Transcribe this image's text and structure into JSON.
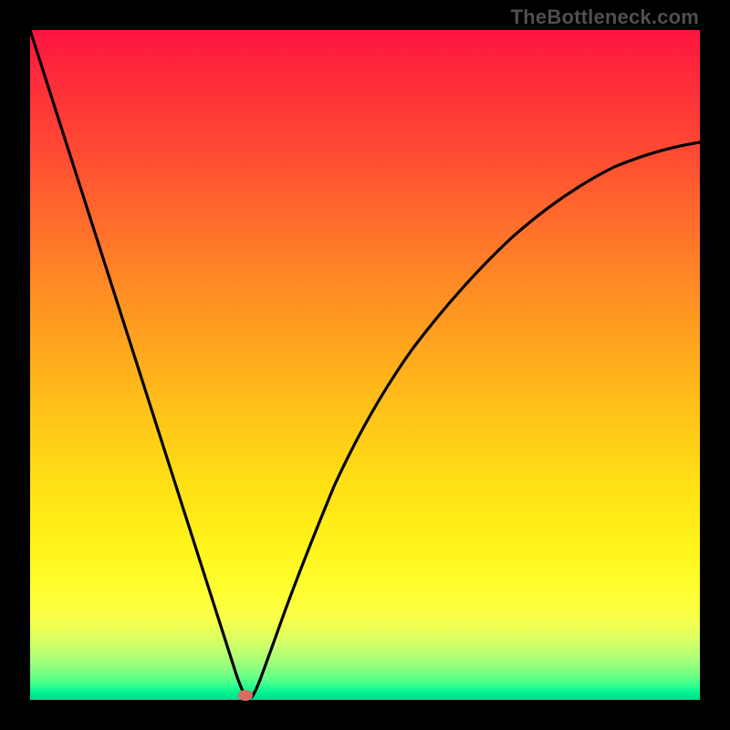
{
  "watermark": "TheBottleneck.com",
  "gradient_colors": {
    "top": "#ff1441",
    "mid_orange": "#ff8a24",
    "mid_yellow": "#fff41a",
    "bottom": "#00df8e"
  },
  "marker": {
    "color": "#d96b62",
    "x_fraction": 0.322,
    "y_fraction": 0.992
  },
  "chart_data": {
    "type": "line",
    "title": "",
    "xlabel": "",
    "ylabel": "",
    "x_range": [
      0,
      100
    ],
    "y_range": [
      0,
      100
    ],
    "series": [
      {
        "name": "left-branch",
        "x": [
          0,
          4,
          8,
          12,
          16,
          20,
          24,
          27,
          29,
          30.5,
          31.5,
          32
        ],
        "y": [
          100,
          87.5,
          75,
          62.5,
          50,
          37.5,
          25,
          15.6,
          9,
          4.3,
          1.6,
          0.5
        ]
      },
      {
        "name": "right-branch",
        "x": [
          32.8,
          33.5,
          35,
          37,
          40,
          44,
          49,
          55,
          62,
          70,
          78,
          86,
          93,
          100
        ],
        "y": [
          0.5,
          2,
          7,
          14,
          23,
          33,
          43,
          52.5,
          60.5,
          67.5,
          73,
          77.3,
          80.4,
          82.8
        ]
      }
    ],
    "annotations": [
      {
        "text": "TheBottleneck.com",
        "position": "top-right"
      }
    ],
    "marker_point": {
      "x": 32.2,
      "y": 0.8
    }
  }
}
